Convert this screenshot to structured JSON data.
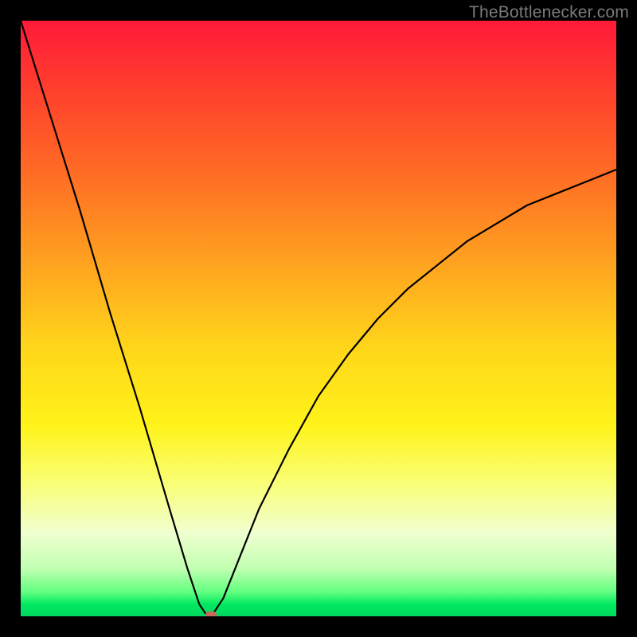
{
  "watermark": "TheBottlenecker.com",
  "chart_data": {
    "type": "line",
    "title": "",
    "xlabel": "",
    "ylabel": "",
    "xlim": [
      0,
      100
    ],
    "ylim": [
      0,
      100
    ],
    "series": [
      {
        "name": "bottleneck-curve",
        "x": [
          0,
          5,
          10,
          15,
          20,
          25,
          28,
          30,
          31,
          32,
          34,
          36,
          40,
          45,
          50,
          55,
          60,
          65,
          70,
          75,
          80,
          85,
          90,
          95,
          100
        ],
        "values": [
          100,
          84,
          68,
          51,
          35,
          18,
          8,
          2,
          0.5,
          0,
          3,
          8,
          18,
          28,
          37,
          44,
          50,
          55,
          59,
          63,
          66,
          69,
          71,
          73,
          75
        ]
      }
    ],
    "annotations": [
      {
        "name": "optimal-point",
        "x": 32,
        "y": 0
      }
    ],
    "background": {
      "type": "vertical-gradient",
      "stops": [
        {
          "pos": 0.0,
          "color": "#ff1a3a"
        },
        {
          "pos": 0.25,
          "color": "#ff6a25"
        },
        {
          "pos": 0.55,
          "color": "#ffd61a"
        },
        {
          "pos": 0.78,
          "color": "#f9ff7a"
        },
        {
          "pos": 0.96,
          "color": "#60ff80"
        },
        {
          "pos": 1.0,
          "color": "#00d860"
        }
      ]
    }
  }
}
